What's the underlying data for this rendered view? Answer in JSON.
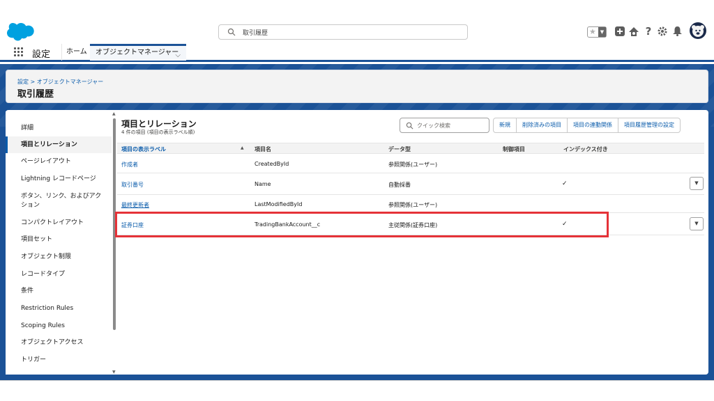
{
  "header": {
    "search_text": "取引履歴"
  },
  "nav": {
    "app_name": "設定",
    "tabs": [
      {
        "label": "ホーム"
      },
      {
        "label": "オブジェクトマネージャー"
      }
    ]
  },
  "page": {
    "breadcrumb": "設定 > オブジェクトマネージャー",
    "title": "取引履歴"
  },
  "sidebar": {
    "items": [
      {
        "label": "詳細"
      },
      {
        "label": "項目とリレーション"
      },
      {
        "label": "ページレイアウト"
      },
      {
        "label": "Lightning レコードページ"
      },
      {
        "label": "ボタン、リンク、およびアク"
      },
      {
        "label": "ション"
      },
      {
        "label": "コンパクトレイアウト"
      },
      {
        "label": "項目セット"
      },
      {
        "label": "オブジェクト制限"
      },
      {
        "label": "レコードタイプ"
      },
      {
        "label": "条件"
      },
      {
        "label": "Restriction Rules"
      },
      {
        "label": "Scoping Rules"
      },
      {
        "label": "オブジェクトアクセス"
      },
      {
        "label": "トリガー"
      }
    ]
  },
  "main": {
    "title": "項目とリレーション",
    "subtitle": "4 件の項目 (項目の表示ラベル順)",
    "quick_search_placeholder": "クイック検索",
    "buttons": [
      {
        "label": "新規"
      },
      {
        "label": "削除済みの項目"
      },
      {
        "label": "項目の連動関係"
      },
      {
        "label": "項目履歴管理の設定"
      }
    ],
    "columns": [
      "項目の表示ラベル",
      "項目名",
      "データ型",
      "制御項目",
      "インデックス付き"
    ],
    "rows": [
      {
        "label": "作成者",
        "api": "CreatedById",
        "type": "参照関係(ユーザー)",
        "indexed": ""
      },
      {
        "label": "取引番号",
        "api": "Name",
        "type": "自動採番",
        "indexed": "✓"
      },
      {
        "label": "最終更新者",
        "api": "LastModifiedById",
        "type": "参照関係(ユーザー)",
        "indexed": ""
      },
      {
        "label": "証券口座",
        "api": "TradingBankAccount__c",
        "type": "主従関係(証券口座)",
        "indexed": "✓"
      }
    ]
  },
  "colors": {
    "brand_blue": "#1b5297",
    "link_blue": "#0b5cab",
    "highlight_red": "#e53238"
  }
}
